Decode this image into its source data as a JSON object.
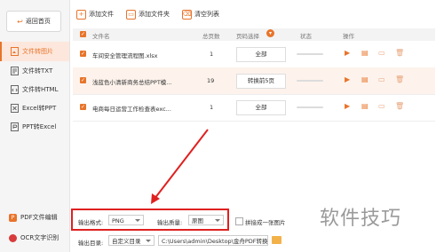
{
  "sidebar": {
    "back_label": "返回首页",
    "items": [
      {
        "label": "文件转图片",
        "active": true
      },
      {
        "label": "文件转TXT"
      },
      {
        "label": "文件转HTML"
      },
      {
        "label": "Excel转PPT"
      },
      {
        "label": "PPT转Excel"
      }
    ],
    "bottom_links": [
      {
        "label": "PDF文件编辑"
      },
      {
        "label": "OCR文字识别"
      }
    ]
  },
  "toolbar": {
    "add_file": "添加文件",
    "add_folder": "添加文件夹",
    "clear_list": "清空列表"
  },
  "table": {
    "headers": [
      "文件名",
      "总页数",
      "页码选择",
      "状态",
      "操作"
    ],
    "rows": [
      {
        "name": "车间安全管理流程图.xlsx",
        "pages": "1",
        "page_select": "全部"
      },
      {
        "name": "浅蓝色小清新商务总结PPT模...",
        "pages": "19",
        "page_select": "转换前5页"
      },
      {
        "name": "电商每日运营工作检查表exc...",
        "pages": "1",
        "page_select": "全部"
      }
    ]
  },
  "output": {
    "format_label": "输出格式:",
    "format_value": "PNG",
    "quality_label": "输出质量:",
    "quality_value": "原图",
    "merge_label": "拼接成一张图片",
    "dir_label": "输出目录:",
    "dir_mode": "自定义目录",
    "dir_path": "C:\\Users\\admin\\Desktop\\金舟PDF转换"
  },
  "watermark": "软件技巧",
  "colors": {
    "accent": "#e8742a",
    "highlight": "#e02020"
  }
}
